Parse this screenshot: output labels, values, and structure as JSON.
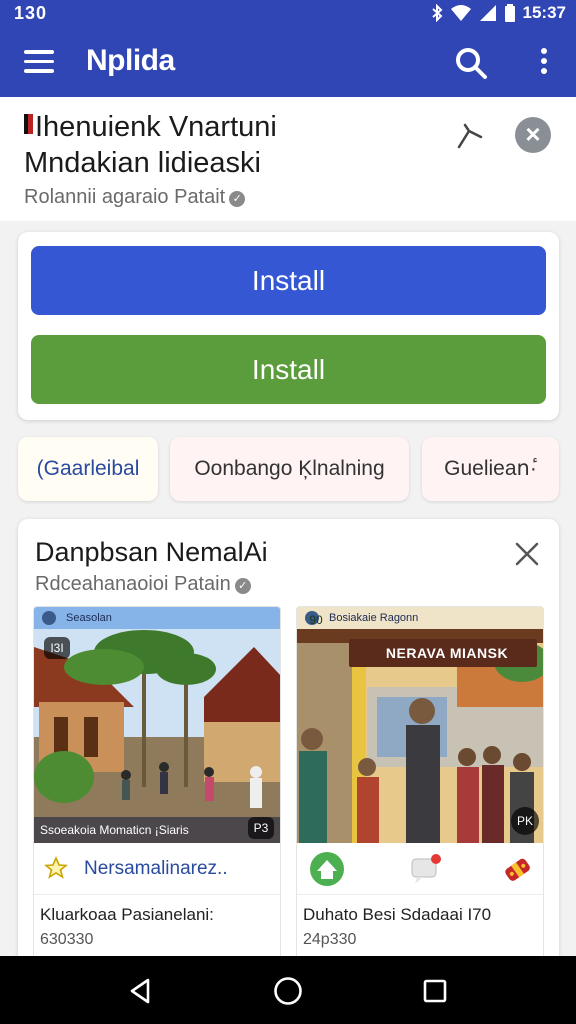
{
  "status_bar": {
    "left_time": "130",
    "clock": "15:37"
  },
  "app_bar": {
    "title": "Nplida",
    "icons": [
      "menu-icon",
      "search-icon",
      "more-vert-icon"
    ]
  },
  "header": {
    "title_line1": "Ihenuienk Vnartuni",
    "title_line2": "Mndakian lidieaski",
    "subtitle": "Rolannii agaraio Patait",
    "icons": [
      "share-icon",
      "close-icon",
      "verified-icon"
    ]
  },
  "install": {
    "primary_label": "Install",
    "secondary_label": "Install"
  },
  "chips": [
    {
      "label": "(Gaarleibal"
    },
    {
      "label": "Oonbango Ķlnalning"
    },
    {
      "label": "Guelieanٔ·"
    }
  ],
  "feed": {
    "title": "Danpbsan NemalAi",
    "subtitle": "Rdceahanaoioi Patain",
    "posts": [
      {
        "photo_header": "Seasolan",
        "photo_caption": "Ssoeakoia Momaticn ¡Siaris",
        "top_badge": "I3I",
        "corner_badge": "P3",
        "action_label": "Nersamalinarez..",
        "name": "Kluarkoaa Pasianelani:",
        "price": "630330"
      },
      {
        "photo_header": "Bosiakaie Ragonn",
        "banner": "NERAVA MIANSK",
        "top_badge": "90",
        "corner_badge": "PK",
        "name": "Duhato Besi Sdadaai I70",
        "price": "24p330"
      }
    ]
  },
  "colors": {
    "app_bar": "#2f46b4",
    "install_primary": "#3557d4",
    "install_secondary": "#5b9c3c"
  }
}
